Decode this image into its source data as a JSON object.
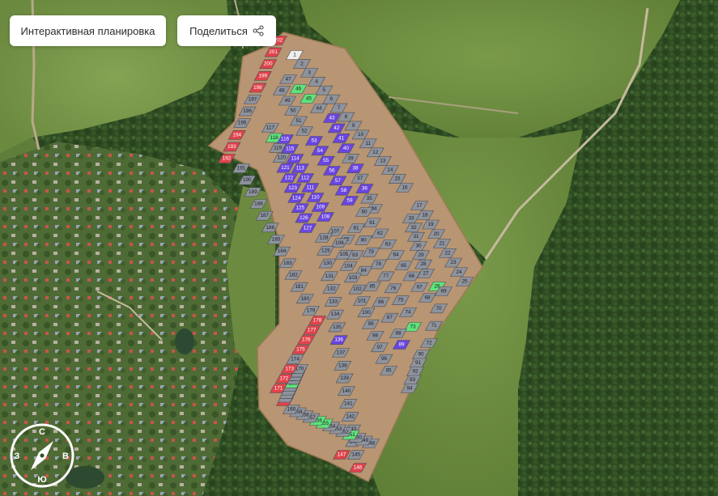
{
  "toolbar": {
    "plan_label": "Интерактивная планировка",
    "share_label": "Поделиться"
  },
  "compass": {
    "north": "С",
    "south": "Ю",
    "west": "З",
    "east": "В"
  },
  "map": {
    "icons": {
      "share": "share-icon",
      "compass": "compass-icon"
    },
    "status_colors": {
      "gray": "#8e939c",
      "red": "#e0434b",
      "green": "#5fe37a",
      "purple": "#6a45e0",
      "white": "#eeeeee"
    },
    "lots": [
      {
        "n": "1",
        "s": "white"
      },
      {
        "n": "2",
        "s": "gray"
      },
      {
        "n": "3",
        "s": "gray"
      },
      {
        "n": "4",
        "s": "gray"
      },
      {
        "n": "5",
        "s": "gray"
      },
      {
        "n": "6",
        "s": "gray"
      },
      {
        "n": "7",
        "s": "gray"
      },
      {
        "n": "8",
        "s": "gray"
      },
      {
        "n": "9",
        "s": "gray"
      },
      {
        "n": "10",
        "s": "gray"
      },
      {
        "n": "11",
        "s": "gray"
      },
      {
        "n": "12",
        "s": "gray"
      },
      {
        "n": "13",
        "s": "gray"
      },
      {
        "n": "14",
        "s": "gray"
      },
      {
        "n": "15",
        "s": "gray"
      },
      {
        "n": "16",
        "s": "gray"
      },
      {
        "n": "17",
        "s": "gray"
      },
      {
        "n": "18",
        "s": "gray"
      },
      {
        "n": "19",
        "s": "gray"
      },
      {
        "n": "20",
        "s": "gray"
      },
      {
        "n": "21",
        "s": "gray"
      },
      {
        "n": "22",
        "s": "gray"
      },
      {
        "n": "23",
        "s": "gray"
      },
      {
        "n": "24",
        "s": "gray"
      },
      {
        "n": "25",
        "s": "gray"
      },
      {
        "n": "26",
        "s": "green"
      },
      {
        "n": "27",
        "s": "gray"
      },
      {
        "n": "28",
        "s": "gray"
      },
      {
        "n": "29",
        "s": "gray"
      },
      {
        "n": "30",
        "s": "gray"
      },
      {
        "n": "31",
        "s": "gray"
      },
      {
        "n": "32",
        "s": "gray"
      },
      {
        "n": "33",
        "s": "gray"
      },
      {
        "n": "34",
        "s": "gray"
      },
      {
        "n": "35",
        "s": "gray"
      },
      {
        "n": "36",
        "s": "purple"
      },
      {
        "n": "37",
        "s": "gray"
      },
      {
        "n": "38",
        "s": "purple"
      },
      {
        "n": "39",
        "s": "gray"
      },
      {
        "n": "40",
        "s": "purple"
      },
      {
        "n": "41",
        "s": "purple"
      },
      {
        "n": "42",
        "s": "purple"
      },
      {
        "n": "43",
        "s": "purple"
      },
      {
        "n": "44",
        "s": "gray"
      },
      {
        "n": "45",
        "s": "green"
      },
      {
        "n": "46",
        "s": "green"
      },
      {
        "n": "47",
        "s": "gray"
      },
      {
        "n": "48",
        "s": "gray"
      },
      {
        "n": "49",
        "s": "gray"
      },
      {
        "n": "50",
        "s": "gray"
      },
      {
        "n": "51",
        "s": "gray"
      },
      {
        "n": "52",
        "s": "gray"
      },
      {
        "n": "53",
        "s": "purple"
      },
      {
        "n": "54",
        "s": "purple"
      },
      {
        "n": "55",
        "s": "purple"
      },
      {
        "n": "56",
        "s": "purple"
      },
      {
        "n": "57",
        "s": "purple"
      },
      {
        "n": "58",
        "s": "purple"
      },
      {
        "n": "59",
        "s": "purple"
      },
      {
        "n": "60",
        "s": "gray"
      },
      {
        "n": "61",
        "s": "gray"
      },
      {
        "n": "62",
        "s": "gray"
      },
      {
        "n": "63",
        "s": "gray"
      },
      {
        "n": "64",
        "s": "gray"
      },
      {
        "n": "65",
        "s": "gray"
      },
      {
        "n": "66",
        "s": "gray"
      },
      {
        "n": "67",
        "s": "gray"
      },
      {
        "n": "68",
        "s": "gray"
      },
      {
        "n": "69",
        "s": "gray"
      },
      {
        "n": "70",
        "s": "gray"
      },
      {
        "n": "71",
        "s": "gray"
      },
      {
        "n": "72",
        "s": "gray"
      },
      {
        "n": "73",
        "s": "green"
      },
      {
        "n": "74",
        "s": "gray"
      },
      {
        "n": "75",
        "s": "gray"
      },
      {
        "n": "76",
        "s": "gray"
      },
      {
        "n": "77",
        "s": "gray"
      },
      {
        "n": "78",
        "s": "gray"
      },
      {
        "n": "79",
        "s": "gray"
      },
      {
        "n": "80",
        "s": "gray"
      },
      {
        "n": "81",
        "s": "gray"
      },
      {
        "n": "82",
        "s": "gray"
      },
      {
        "n": "83",
        "s": "gray"
      },
      {
        "n": "84",
        "s": "gray"
      },
      {
        "n": "85",
        "s": "gray"
      },
      {
        "n": "86",
        "s": "gray"
      },
      {
        "n": "87",
        "s": "gray"
      },
      {
        "n": "88",
        "s": "gray"
      },
      {
        "n": "89",
        "s": "purple"
      },
      {
        "n": "90",
        "s": "gray"
      },
      {
        "n": "91",
        "s": "gray"
      },
      {
        "n": "92",
        "s": "gray"
      },
      {
        "n": "93",
        "s": "gray"
      },
      {
        "n": "94",
        "s": "gray"
      },
      {
        "n": "95",
        "s": "gray"
      },
      {
        "n": "96",
        "s": "gray"
      },
      {
        "n": "97",
        "s": "gray"
      },
      {
        "n": "98",
        "s": "gray"
      },
      {
        "n": "99",
        "s": "gray"
      },
      {
        "n": "100",
        "s": "gray"
      },
      {
        "n": "101",
        "s": "gray"
      },
      {
        "n": "102",
        "s": "gray"
      },
      {
        "n": "103",
        "s": "gray"
      },
      {
        "n": "104",
        "s": "gray"
      },
      {
        "n": "105",
        "s": "gray"
      },
      {
        "n": "106",
        "s": "gray"
      },
      {
        "n": "107",
        "s": "gray"
      },
      {
        "n": "108",
        "s": "purple"
      },
      {
        "n": "109",
        "s": "purple"
      },
      {
        "n": "110",
        "s": "purple"
      },
      {
        "n": "111",
        "s": "purple"
      },
      {
        "n": "112",
        "s": "purple"
      },
      {
        "n": "113",
        "s": "purple"
      },
      {
        "n": "114",
        "s": "purple"
      },
      {
        "n": "115",
        "s": "purple"
      },
      {
        "n": "116",
        "s": "purple"
      },
      {
        "n": "117",
        "s": "gray"
      },
      {
        "n": "118",
        "s": "green"
      },
      {
        "n": "119",
        "s": "gray"
      },
      {
        "n": "120",
        "s": "gray"
      },
      {
        "n": "121",
        "s": "purple"
      },
      {
        "n": "122",
        "s": "purple"
      },
      {
        "n": "123",
        "s": "purple"
      },
      {
        "n": "124",
        "s": "purple"
      },
      {
        "n": "125",
        "s": "purple"
      },
      {
        "n": "126",
        "s": "purple"
      },
      {
        "n": "127",
        "s": "purple"
      },
      {
        "n": "128",
        "s": "gray"
      },
      {
        "n": "129",
        "s": "gray"
      },
      {
        "n": "130",
        "s": "gray"
      },
      {
        "n": "131",
        "s": "gray"
      },
      {
        "n": "132",
        "s": "gray"
      },
      {
        "n": "133",
        "s": "gray"
      },
      {
        "n": "134",
        "s": "gray"
      },
      {
        "n": "135",
        "s": "gray"
      },
      {
        "n": "136",
        "s": "purple"
      },
      {
        "n": "137",
        "s": "gray"
      },
      {
        "n": "138",
        "s": "gray"
      },
      {
        "n": "139",
        "s": "gray"
      },
      {
        "n": "140",
        "s": "gray"
      },
      {
        "n": "141",
        "s": "gray"
      },
      {
        "n": "142",
        "s": "gray"
      },
      {
        "n": "143",
        "s": "gray"
      },
      {
        "n": "144",
        "s": "gray"
      },
      {
        "n": "145",
        "s": "gray"
      },
      {
        "n": "146",
        "s": "red"
      },
      {
        "n": "147",
        "s": "red"
      },
      {
        "n": "148",
        "s": "gray"
      },
      {
        "n": "149",
        "s": "gray"
      },
      {
        "n": "150",
        "s": "gray"
      },
      {
        "n": "151",
        "s": "green"
      },
      {
        "n": "152",
        "s": "gray"
      },
      {
        "n": "153",
        "s": "gray"
      },
      {
        "n": "154",
        "s": "gray"
      },
      {
        "n": "155",
        "s": "green"
      },
      {
        "n": "156",
        "s": "green"
      },
      {
        "n": "157",
        "s": "gray"
      },
      {
        "n": "158",
        "s": "gray"
      },
      {
        "n": "159",
        "s": "gray"
      },
      {
        "n": "160",
        "s": "gray"
      },
      {
        "n": "161",
        "s": "red"
      },
      {
        "n": "162",
        "s": "gray"
      },
      {
        "n": "163",
        "s": "gray"
      },
      {
        "n": "164",
        "s": "gray"
      },
      {
        "n": "165",
        "s": "gray"
      },
      {
        "n": "166",
        "s": "green"
      },
      {
        "n": "167",
        "s": "gray"
      },
      {
        "n": "168",
        "s": "gray"
      },
      {
        "n": "169",
        "s": "gray"
      },
      {
        "n": "170",
        "s": "gray"
      },
      {
        "n": "171",
        "s": "red"
      },
      {
        "n": "172",
        "s": "red"
      },
      {
        "n": "173",
        "s": "red"
      },
      {
        "n": "174",
        "s": "gray"
      },
      {
        "n": "175",
        "s": "red"
      },
      {
        "n": "176",
        "s": "red"
      },
      {
        "n": "177",
        "s": "red"
      },
      {
        "n": "178",
        "s": "red"
      },
      {
        "n": "179",
        "s": "gray"
      },
      {
        "n": "180",
        "s": "gray"
      },
      {
        "n": "181",
        "s": "gray"
      },
      {
        "n": "182",
        "s": "gray"
      },
      {
        "n": "183",
        "s": "gray"
      },
      {
        "n": "184",
        "s": "gray"
      },
      {
        "n": "185",
        "s": "gray"
      },
      {
        "n": "186",
        "s": "gray"
      },
      {
        "n": "187",
        "s": "gray"
      },
      {
        "n": "188",
        "s": "gray"
      },
      {
        "n": "189",
        "s": "gray"
      },
      {
        "n": "190",
        "s": "gray"
      },
      {
        "n": "191",
        "s": "gray"
      },
      {
        "n": "192",
        "s": "red"
      },
      {
        "n": "193",
        "s": "red"
      },
      {
        "n": "194",
        "s": "red"
      },
      {
        "n": "195",
        "s": "gray"
      },
      {
        "n": "196",
        "s": "gray"
      },
      {
        "n": "197",
        "s": "gray"
      },
      {
        "n": "198",
        "s": "red"
      },
      {
        "n": "199",
        "s": "red"
      },
      {
        "n": "200",
        "s": "red"
      },
      {
        "n": "201",
        "s": "red"
      },
      {
        "n": "202",
        "s": "red"
      }
    ]
  }
}
